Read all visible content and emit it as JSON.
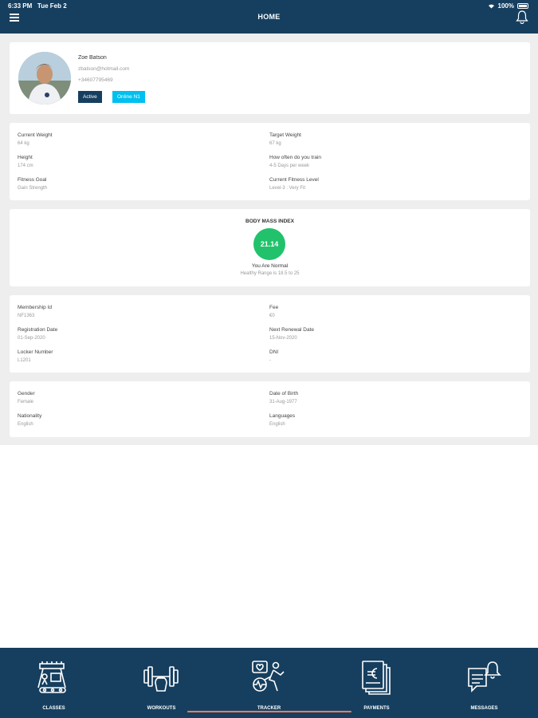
{
  "status_bar": {
    "time": "6:33 PM",
    "date": "Tue Feb 2",
    "battery": "100%"
  },
  "header": {
    "title": "HOME",
    "menu_icon": "hamburger-icon",
    "bell_icon": "bell-icon"
  },
  "profile": {
    "name": "Zoe Batson",
    "email": "zbatson@hotmail.com",
    "phone": "+34607795469",
    "status_badge": "Active",
    "plan_badge": "Online N1",
    "colors": {
      "active": "#163f5f",
      "online": "#00c0f0"
    }
  },
  "stats": {
    "current_weight": {
      "label": "Current Weight",
      "value": "64 kg"
    },
    "target_weight": {
      "label": "Target Weight",
      "value": "67 kg"
    },
    "height": {
      "label": "Height",
      "value": "174 cm"
    },
    "training_frequency": {
      "label": "How often do you train",
      "value": "4-5 Days per week"
    },
    "fitness_goal": {
      "label": "Fitness Goal",
      "value": "Gain Strength"
    },
    "fitness_level": {
      "label": "Current Fitness Level",
      "value": "Level-3 : Very Fit"
    }
  },
  "bmi": {
    "title": "BODY MASS INDEX",
    "value": "21.14",
    "status": "You Are Normal",
    "range": "Healthy Range is 18.5 to 25",
    "color": "#21c26b"
  },
  "membership": {
    "membership_id": {
      "label": "Membership Id",
      "value": "NF1363"
    },
    "fee": {
      "label": "Fee",
      "value": "€0"
    },
    "registration_date": {
      "label": "Registration Date",
      "value": "01-Sep-2020"
    },
    "next_renewal_date": {
      "label": "Next Renewal Date",
      "value": "15-Nov-2020"
    },
    "locker_number": {
      "label": "Locker Number",
      "value": "L1201"
    },
    "dni": {
      "label": "DNI",
      "value": "-"
    }
  },
  "personal": {
    "gender": {
      "label": "Gender",
      "value": "Female"
    },
    "date_of_birth": {
      "label": "Date of Birth",
      "value": "31-Aug-1977"
    },
    "nationality": {
      "label": "Nationality",
      "value": "English"
    },
    "languages": {
      "label": "Languages",
      "value": "English"
    }
  },
  "tabs": [
    {
      "label": "CLASSES",
      "icon": "classes-icon"
    },
    {
      "label": "WORKOUTS",
      "icon": "dumbbell-icon"
    },
    {
      "label": "TRACKER",
      "icon": "tracker-icon"
    },
    {
      "label": "PAYMENTS",
      "icon": "euro-document-icon"
    },
    {
      "label": "MESSAGES",
      "icon": "message-bell-icon"
    }
  ],
  "theme": {
    "primary": "#163f5f",
    "background": "#eeeeee"
  }
}
